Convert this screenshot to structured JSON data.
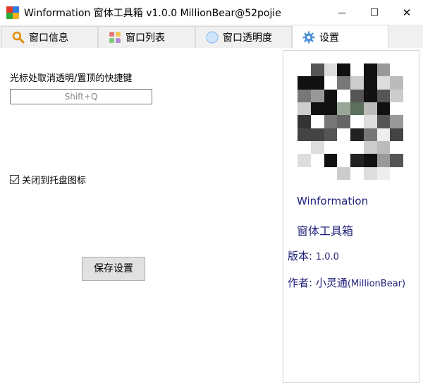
{
  "window": {
    "title": "Winformation 窗体工具箱 v1.0.0  MillionBear@52pojie",
    "controls": {
      "minimize": "—",
      "maximize": "☐",
      "close": "✕"
    }
  },
  "tabs": [
    {
      "label": "窗口信息",
      "icon": "magnifier-icon",
      "active": false
    },
    {
      "label": "窗口列表",
      "icon": "list-blocks-icon",
      "active": false
    },
    {
      "label": "窗口透明度",
      "icon": "circle-transparency-icon",
      "active": false
    },
    {
      "label": "设置",
      "icon": "gear-icon",
      "active": true
    }
  ],
  "settings": {
    "hotkey_label": "光标处取消透明/置顶的快捷键",
    "hotkey_value": "Shift+Q",
    "tray_checkbox_label": "关闭到托盘图标",
    "tray_checked": true,
    "save_label": "保存设置"
  },
  "about": {
    "app_name": "Winformation",
    "app_subtitle": "窗体工具箱",
    "version_label": "版本:",
    "version_value": "1.0.0",
    "author_label": "作者:",
    "author_value": "小灵通",
    "author_handle": "(MillionBear)"
  },
  "colors": {
    "accent_text": "#1f1f7a",
    "tab_bg": "#f0f0f0",
    "button_bg": "#e1e1e1"
  }
}
